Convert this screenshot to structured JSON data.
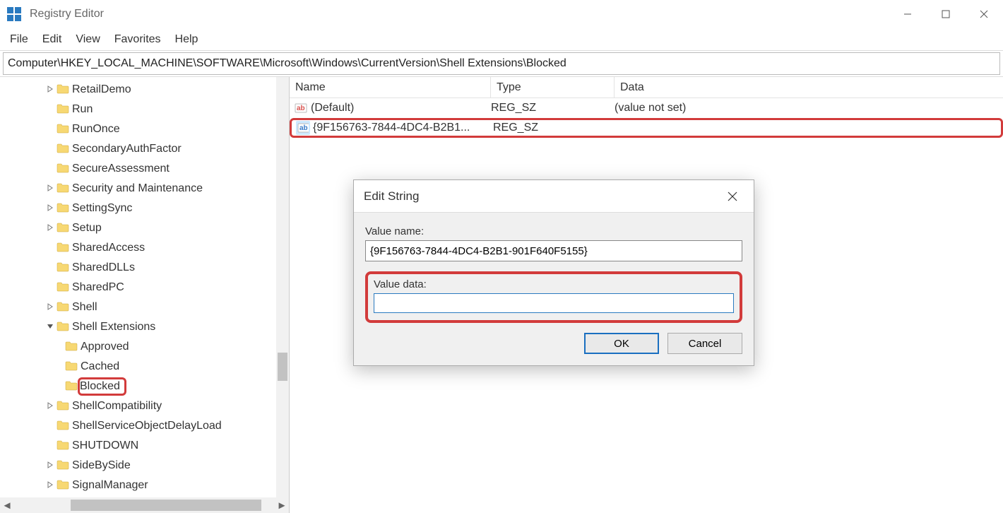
{
  "window": {
    "title": "Registry Editor"
  },
  "menu": {
    "file": "File",
    "edit": "Edit",
    "view": "View",
    "favorites": "Favorites",
    "help": "Help"
  },
  "address": "Computer\\HKEY_LOCAL_MACHINE\\SOFTWARE\\Microsoft\\Windows\\CurrentVersion\\Shell Extensions\\Blocked",
  "tree": [
    {
      "label": "RetailDemo",
      "depth": 4,
      "caret": ">"
    },
    {
      "label": "Run",
      "depth": 4,
      "caret": ""
    },
    {
      "label": "RunOnce",
      "depth": 4,
      "caret": ""
    },
    {
      "label": "SecondaryAuthFactor",
      "depth": 4,
      "caret": ""
    },
    {
      "label": "SecureAssessment",
      "depth": 4,
      "caret": ""
    },
    {
      "label": "Security and Maintenance",
      "depth": 4,
      "caret": ">"
    },
    {
      "label": "SettingSync",
      "depth": 4,
      "caret": ">"
    },
    {
      "label": "Setup",
      "depth": 4,
      "caret": ">"
    },
    {
      "label": "SharedAccess",
      "depth": 4,
      "caret": ""
    },
    {
      "label": "SharedDLLs",
      "depth": 4,
      "caret": ""
    },
    {
      "label": "SharedPC",
      "depth": 4,
      "caret": ""
    },
    {
      "label": "Shell",
      "depth": 4,
      "caret": ">"
    },
    {
      "label": "Shell Extensions",
      "depth": 4,
      "caret": "v"
    },
    {
      "label": "Approved",
      "depth": 5,
      "caret": ""
    },
    {
      "label": "Cached",
      "depth": 5,
      "caret": ""
    },
    {
      "label": "Blocked",
      "depth": 5,
      "caret": "",
      "highlight": true
    },
    {
      "label": "ShellCompatibility",
      "depth": 4,
      "caret": ">"
    },
    {
      "label": "ShellServiceObjectDelayLoad",
      "depth": 4,
      "caret": ""
    },
    {
      "label": "SHUTDOWN",
      "depth": 4,
      "caret": ""
    },
    {
      "label": "SideBySide",
      "depth": 4,
      "caret": ">"
    },
    {
      "label": "SignalManager",
      "depth": 4,
      "caret": ">"
    }
  ],
  "values": {
    "headers": {
      "name": "Name",
      "type": "Type",
      "data": "Data"
    },
    "rows": [
      {
        "name": "(Default)",
        "type": "REG_SZ",
        "data": "(value not set)",
        "iconColor": "#d9534f",
        "highlighted": false
      },
      {
        "name": "{9F156763-7844-4DC4-B2B1...",
        "type": "REG_SZ",
        "data": "",
        "iconColor": "#3a7bc8",
        "highlighted": true
      }
    ]
  },
  "dialog": {
    "title": "Edit String",
    "valueNameLabel": "Value name:",
    "valueName": "{9F156763-7844-4DC4-B2B1-901F640F5155}",
    "valueDataLabel": "Value data:",
    "valueData": "",
    "ok": "OK",
    "cancel": "Cancel"
  }
}
